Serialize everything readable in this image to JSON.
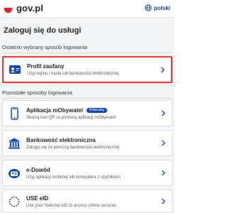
{
  "header": {
    "brand": "gov.pl",
    "language": "polski"
  },
  "main": {
    "title": "Zaloguj się do usługi",
    "recent_section": "Ostatnio wybrany sposób logowania",
    "other_section": "Pozostałe sposoby logowania"
  },
  "recent_method": {
    "title": "Profil zaufany",
    "description": "Użyj loginu i hasła lub bankowości elektronicznej",
    "icon": "trusted-profile-icon"
  },
  "other_methods": [
    {
      "title": "Aplikacja mObywatel",
      "badge": "Polecany",
      "description": "Skanuj kod QR za pomocą aplikacji mObywatel",
      "icon": "phone-icon"
    },
    {
      "title": "Bankowość elektroniczna",
      "description": "Zaloguj się za pomocą bankowości elektronicznej",
      "icon": "bank-icon"
    },
    {
      "title": "e-Dowód",
      "description": "Użyj aplikacji mobilnej lub komputera z czytnikiem",
      "icon": "id-card-icon"
    },
    {
      "title": "USE eID",
      "description": "Use your National eID to access online services",
      "icon": "eu-stars-icon"
    }
  ],
  "colors": {
    "accent_blue": "#0b3ea8",
    "selected_border": "#e02b2b",
    "page_background": "#f3f4f6"
  }
}
